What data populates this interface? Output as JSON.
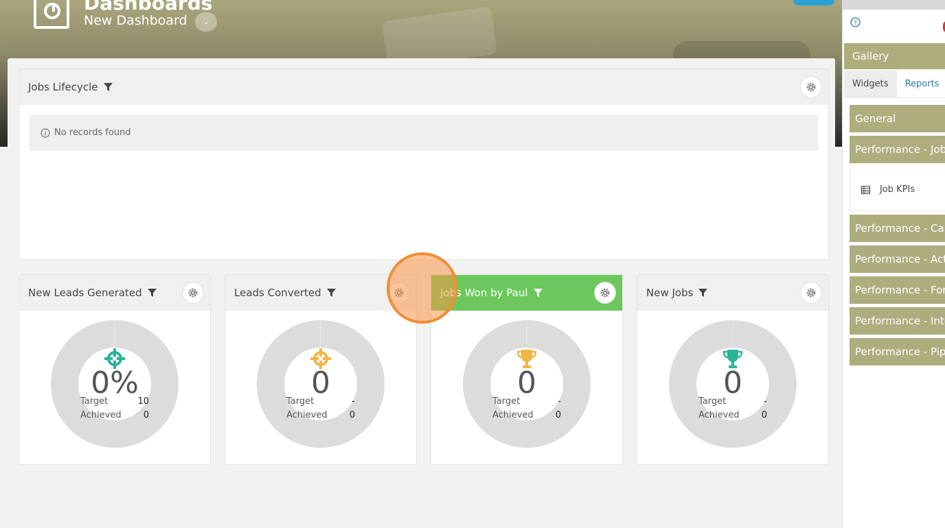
{
  "header": {
    "title": "Dashboards",
    "subtitle": "New Dashboard",
    "caret": "⌄"
  },
  "lifecycle": {
    "title": "Jobs Lifecycle",
    "empty_message": "No records found"
  },
  "kpis": [
    {
      "title": "New Leads Generated",
      "value": "0%",
      "target_label": "Target",
      "target": "10",
      "achieved_label": "Achieved",
      "achieved": "0",
      "icon": "crosshair-icon",
      "icon_color": "#2bb39b"
    },
    {
      "title": "Leads Converted",
      "value": "0",
      "target_label": "Target",
      "target": "-",
      "achieved_label": "Achieved",
      "achieved": "0",
      "icon": "crosshair-icon",
      "icon_color": "#f3b642"
    },
    {
      "title": "Jobs Won by Paul",
      "value": "0",
      "target_label": "Target",
      "target": "-",
      "achieved_label": "Achieved",
      "achieved": "0",
      "icon": "trophy-icon",
      "icon_color": "#f3b642",
      "head_color": "#6cc75c"
    },
    {
      "title": "New Jobs",
      "value": "0",
      "target_label": "Target",
      "target": "-",
      "achieved_label": "Achieved",
      "achieved": "0",
      "icon": "trophy-icon",
      "icon_color": "#2bb39b"
    }
  ],
  "sidebar": {
    "gallery_title": "Gallery",
    "tabs": [
      "Widgets",
      "Reports"
    ],
    "sections": [
      "General",
      "Performance - Jobs",
      "Performance - Can",
      "Performance - Act",
      "Performance - For",
      "Performance - Inte",
      "Performance - Pip"
    ],
    "sub_item": "Job KPIs"
  },
  "colors": {
    "accent": "#aead7e",
    "green_header": "#6cc75c",
    "link": "#2b7aa6"
  }
}
